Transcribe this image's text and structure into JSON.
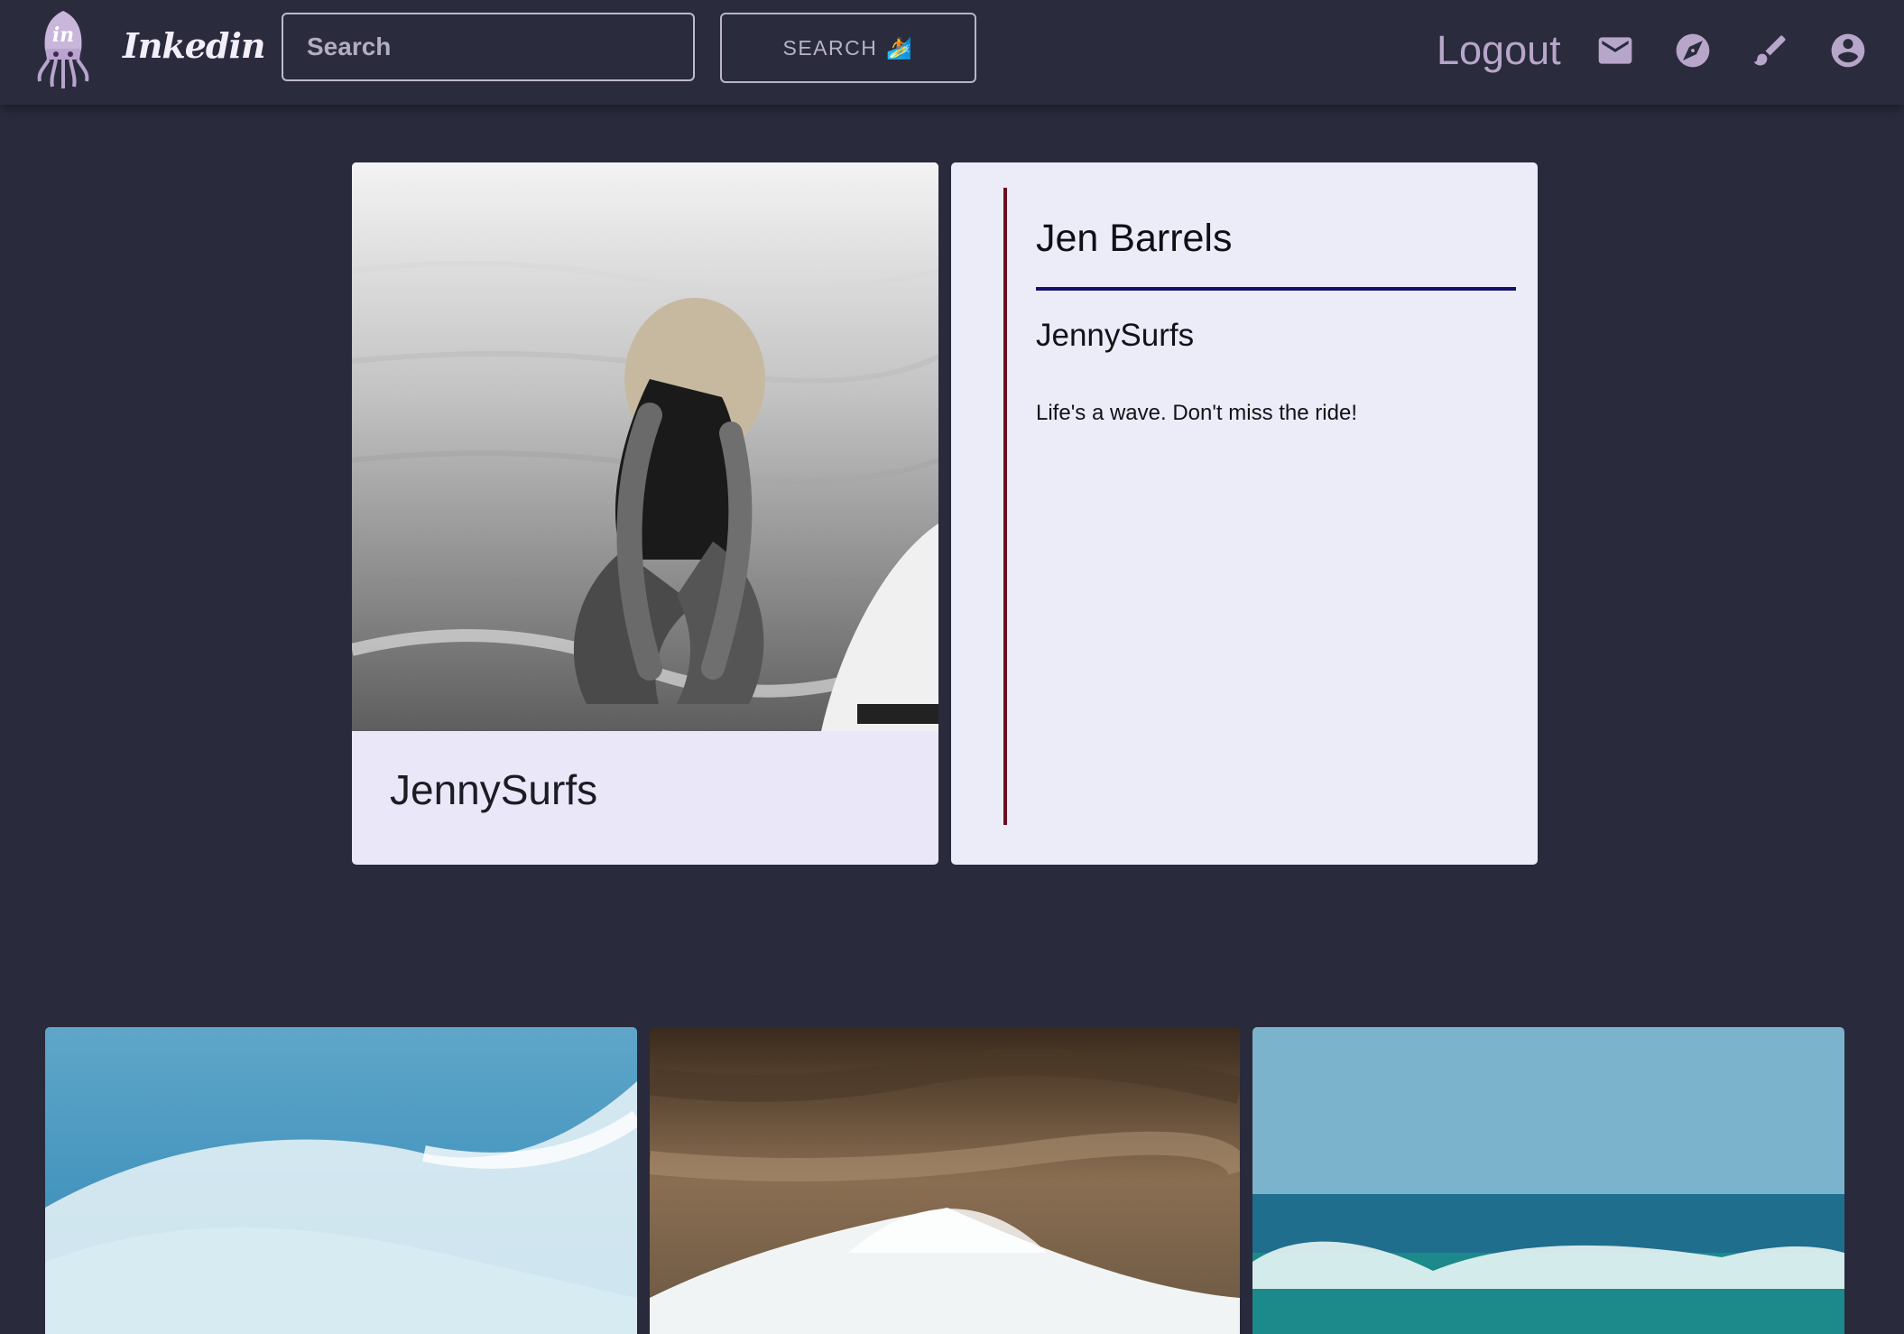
{
  "app": {
    "brand": "Inkedin",
    "logo_text": "in"
  },
  "header": {
    "search_placeholder": "Search",
    "search_button_label": "SEARCH",
    "search_button_emoji": "🏄",
    "logout_label": "Logout",
    "icons": [
      "mail-icon",
      "explore-icon",
      "brush-icon",
      "account-circle-icon"
    ],
    "accent_color": "#b7a6c9"
  },
  "profile": {
    "photo_caption": "JennySurfs",
    "name": "Jen Barrels",
    "handle": "JennySurfs",
    "bio": "Life's a wave. Don't miss the ride!"
  },
  "gallery": {
    "tiles": [
      {
        "kind": "breaking-wave-photo"
      },
      {
        "kind": "wave-against-rocks-photo"
      },
      {
        "kind": "ocean-horizon-wave-photo"
      }
    ]
  },
  "colors": {
    "background": "#292a3b",
    "card": "#eae8f8",
    "divider_red": "#6a0f22",
    "underline_blue": "#14126d"
  }
}
